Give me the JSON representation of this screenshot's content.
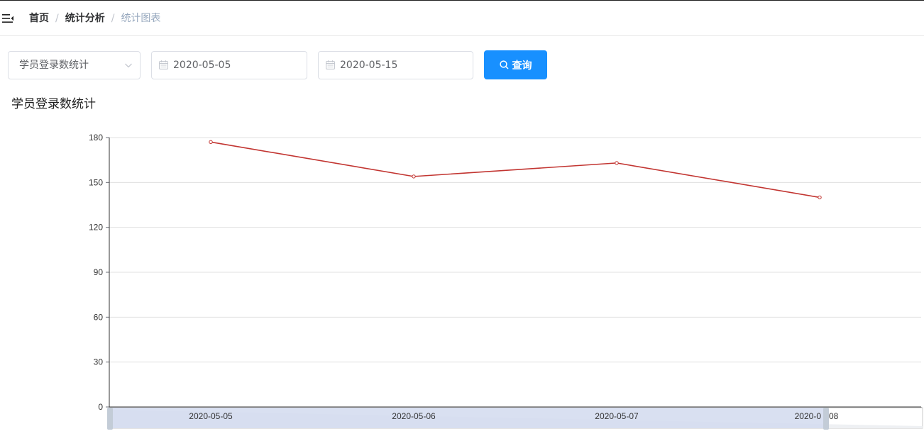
{
  "breadcrumb": {
    "items": [
      "首页",
      "统计分析",
      "统计图表"
    ],
    "separator": "/"
  },
  "filters": {
    "type_select": {
      "value": "学员登录数统计"
    },
    "start_date": {
      "value": "2020-05-05"
    },
    "end_date": {
      "value": "2020-05-15"
    },
    "query_button": {
      "label": "查询"
    }
  },
  "section_title": "学员登录数统计",
  "colors": {
    "accent": "#1890ff",
    "line": "#c23531",
    "grid": "#e0e0e0",
    "data_zoom": "#d2dbee"
  },
  "chart_data": {
    "type": "line",
    "categories": [
      "2020-05-05",
      "2020-05-06",
      "2020-05-07",
      "2020-05-08"
    ],
    "series": [
      {
        "values": [
          177,
          154,
          163,
          140
        ]
      }
    ],
    "ylim": [
      0,
      180
    ],
    "yticks": [
      "0",
      "30",
      "60",
      "90",
      "120",
      "150",
      "180"
    ],
    "xtick_labels": [
      "2020-05-05",
      "2020-05-06",
      "2020-05-07",
      "2020-0",
      "08"
    ],
    "grid": true,
    "data_zoom": true
  }
}
